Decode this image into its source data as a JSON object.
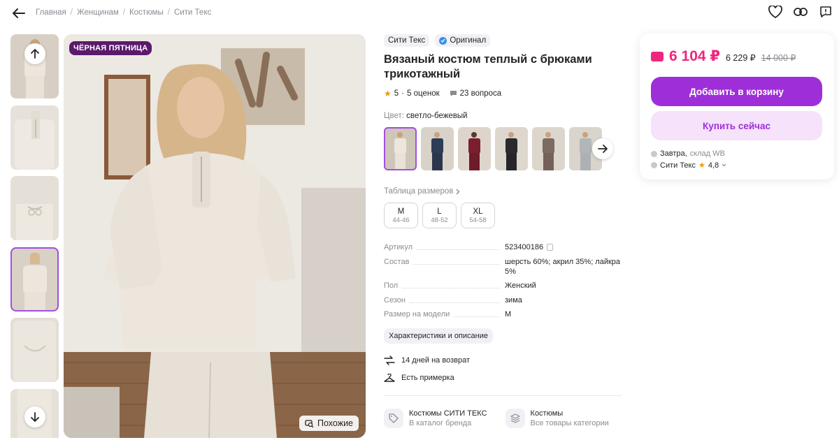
{
  "nav": {
    "breadcrumbs": [
      "Главная",
      "Женщинам",
      "Костюмы",
      "Сити Текс"
    ]
  },
  "gallery": {
    "promo_badge": "ЧЁРНАЯ ПЯТНИЦА",
    "similar_label": "Похожие",
    "thumbnail_count": 6,
    "selected_thumbnail": 4
  },
  "product": {
    "brand": "Сити Текс",
    "original_badge": "Оригинал",
    "title": "Вязаный костюм теплый с брюками трикотажный",
    "rating": "5",
    "reviews": "5 оценок",
    "questions": "23 вопроса",
    "color_label": "Цвет:",
    "color_value": "светло-бежевый",
    "size_table_label": "Таблица размеров",
    "sizes": [
      {
        "label": "M",
        "range": "44-46"
      },
      {
        "label": "L",
        "range": "48-52"
      },
      {
        "label": "XL",
        "range": "54-58"
      }
    ],
    "specs": [
      {
        "key": "Артикул",
        "value": "523400186"
      },
      {
        "key": "Состав",
        "value": "шерсть 60%; акрил 35%; лайкра 5%"
      },
      {
        "key": "Пол",
        "value": "Женский"
      },
      {
        "key": "Сезон",
        "value": "зима"
      },
      {
        "key": "Размер на модели",
        "value": "M"
      }
    ],
    "characteristics_chip": "Характеристики и описание",
    "features": [
      "14 дней на возврат",
      "Есть примерка"
    ],
    "catalog": [
      {
        "title": "Костюмы СИТИ ТЕКС",
        "subtitle": "В каталог бренда"
      },
      {
        "title": "Костюмы",
        "subtitle": "Все товары категории"
      }
    ]
  },
  "buy": {
    "price": "6 104 ₽",
    "price_alt": "6 229 ₽",
    "price_old": "14 000 ₽",
    "add_to_cart": "Добавить в корзину",
    "buy_now": "Купить сейчас",
    "delivery": "Завтра,",
    "warehouse": "склад WB",
    "seller": "Сити Текс",
    "seller_rating": "4,8"
  },
  "colors": {
    "accent": "#9e2fd8",
    "price": "#f0267d",
    "badge": "#5a1a6b"
  }
}
